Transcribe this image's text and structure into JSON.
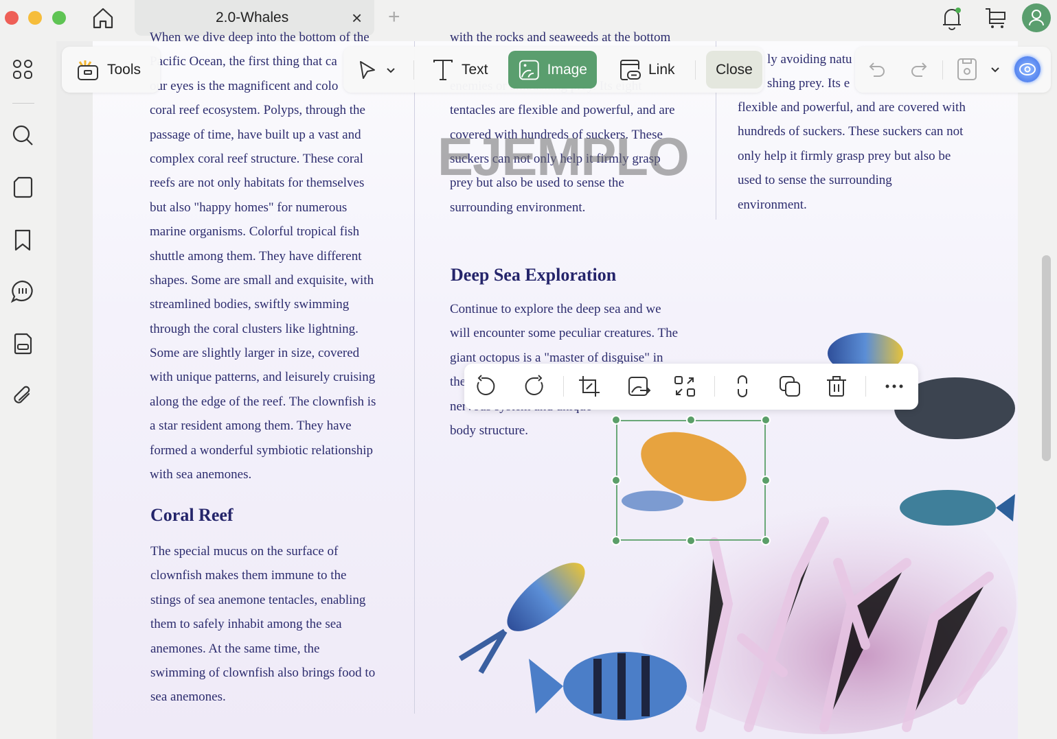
{
  "window": {
    "tab_title": "2.0-Whales",
    "close_tab": "×",
    "new_tab": "+"
  },
  "toolbar": {
    "tools": "Tools",
    "text": "Text",
    "image": "Image",
    "link": "Link",
    "close": "Close"
  },
  "watermark": "EJEMPLO",
  "columns": {
    "col1": [
      "When we dive deep into the bottom of the",
      "Pacific Ocean, the first thing that ca",
      "our eyes is the magnificent and colo",
      "coral reef ecosystem. Polyps, through the",
      "passage of time, have built up a vast and",
      "complex coral reef structure. These coral",
      "reefs are not only habitats for themselves",
      "but also \"happy homes\" for numerous",
      "marine organisms. Colorful tropical fish",
      "shuttle among them. They have different",
      "shapes. Some are small and exquisite, with",
      "streamlined bodies, swiftly swimming",
      "through the coral clusters like lightning.",
      "Some are slightly larger in size, covered",
      "with unique patterns, and leisurely cruising",
      "along the edge of the reef. The clownfish is",
      "a star resident among them. They have",
      "formed a wonderful symbiotic relationship",
      "with sea anemones."
    ],
    "col2": [
      "with the rocks and seaweeds at the bottom",
      "",
      "enemies or ambushing prey. Its eight",
      "tentacles are flexible and powerful, and are",
      "covered with hundreds of suckers. These",
      "suckers can not only help it firmly grasp",
      "prey but also be used to sense the",
      "surrounding environment."
    ],
    "col3_partial": [
      "ly avoiding natu",
      "shing prey. Its e"
    ],
    "col3": [
      "flexible and powerful, and are covered with",
      "hundreds of suckers. These suckers can not",
      "only help it firmly grasp prey but also be",
      "used to sense the surrounding",
      "environment."
    ]
  },
  "deep_sea": {
    "heading": "Deep Sea Exploration",
    "lines": [
      "Continue to explore the deep sea and we",
      "will encounter some peculiar creatures. The",
      "giant octopus is a \"master of disguise\" in",
      "the",
      "nervous system and unique",
      "body structure."
    ]
  },
  "coral_reef": {
    "heading": "Coral Reef",
    "lines": [
      " The special mucus on the surface of",
      "clownfish makes them immune to the",
      "stings of sea anemone tentacles, enabling",
      "them to safely inhabit among the sea",
      "anemones. At the same time, the",
      "swimming of clownfish also brings food to",
      "sea anemones."
    ]
  },
  "colors": {
    "accent": "#5a9e6e",
    "text": "#2c2c6e"
  }
}
